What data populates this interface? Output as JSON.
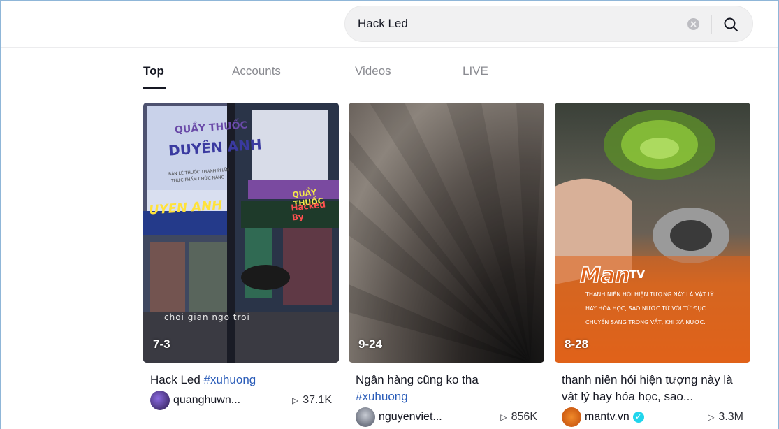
{
  "search": {
    "query": "Hack Led",
    "clear_icon": "clear-x-icon",
    "search_icon": "magnifier-icon"
  },
  "tabs": [
    {
      "label": "Top",
      "active": true
    },
    {
      "label": "Accounts",
      "active": false
    },
    {
      "label": "Videos",
      "active": false
    },
    {
      "label": "LIVE",
      "active": false
    }
  ],
  "videos": [
    {
      "date": "7-3",
      "caption": "Hack Led ",
      "hashtag": "#xuhuong",
      "username": "quanghuwn...",
      "views": "37.1K",
      "thumb_text": {
        "sign1": "QUẦY THUỐC",
        "sign2": "DUYÊN ANH",
        "sign3": "BÁN LẺ THUỐC THÀNH PHẨM",
        "sign4": "THỰC PHẨM CHỨC NĂNG",
        "sign5": "QUẦY THUỐC",
        "led1": "UYEN ANH",
        "led2": "Hacked By",
        "overlay": "choi gian ngo troi"
      }
    },
    {
      "date": "9-24",
      "caption": "Ngân hàng cũng ko tha ",
      "hashtag": "#xuhuong",
      "username": "nguyenviet...",
      "views": "856K"
    },
    {
      "date": "8-28",
      "caption": "thanh niên hỏi hiện tượng này là vật lý hay hóa học, sao...",
      "hashtag": "",
      "username": "mantv.vn",
      "verified": true,
      "views": "3.3M",
      "thumb_text": {
        "brand": "Man",
        "brand2": "TV",
        "line1": "THANH NIÊN HỎI HIỆN TƯỢNG NÀY LÀ VẬT LÝ",
        "line2": "HAY HÓA HỌC, SAO NƯỚC TỪ VÒI TỪ ĐỤC",
        "line3": "CHUYỂN SANG TRONG VẮT, KHI XẢ NƯỚC."
      }
    }
  ]
}
